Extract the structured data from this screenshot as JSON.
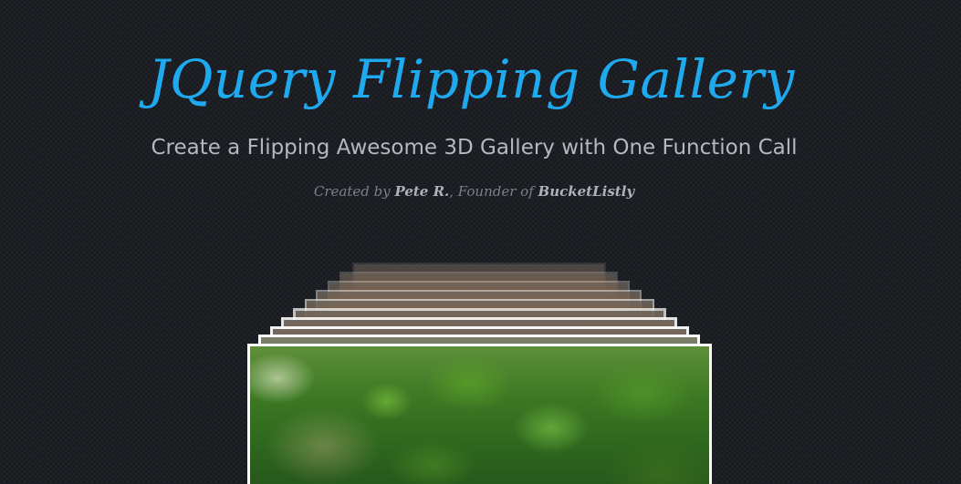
{
  "header": {
    "title": "JQuery Flipping Gallery",
    "subtitle": "Create a Flipping Awesome 3D Gallery with One Function Call",
    "credit": {
      "prefix": "Created by ",
      "author": "Pete R.",
      "middle": ", Founder of ",
      "company": "BucketListly"
    }
  },
  "colors": {
    "background": "#1c1f24",
    "title": "#1fa9ee",
    "subtitle": "#b4b9bf",
    "credit": "#7b8087",
    "card_border": "#ffffff"
  }
}
